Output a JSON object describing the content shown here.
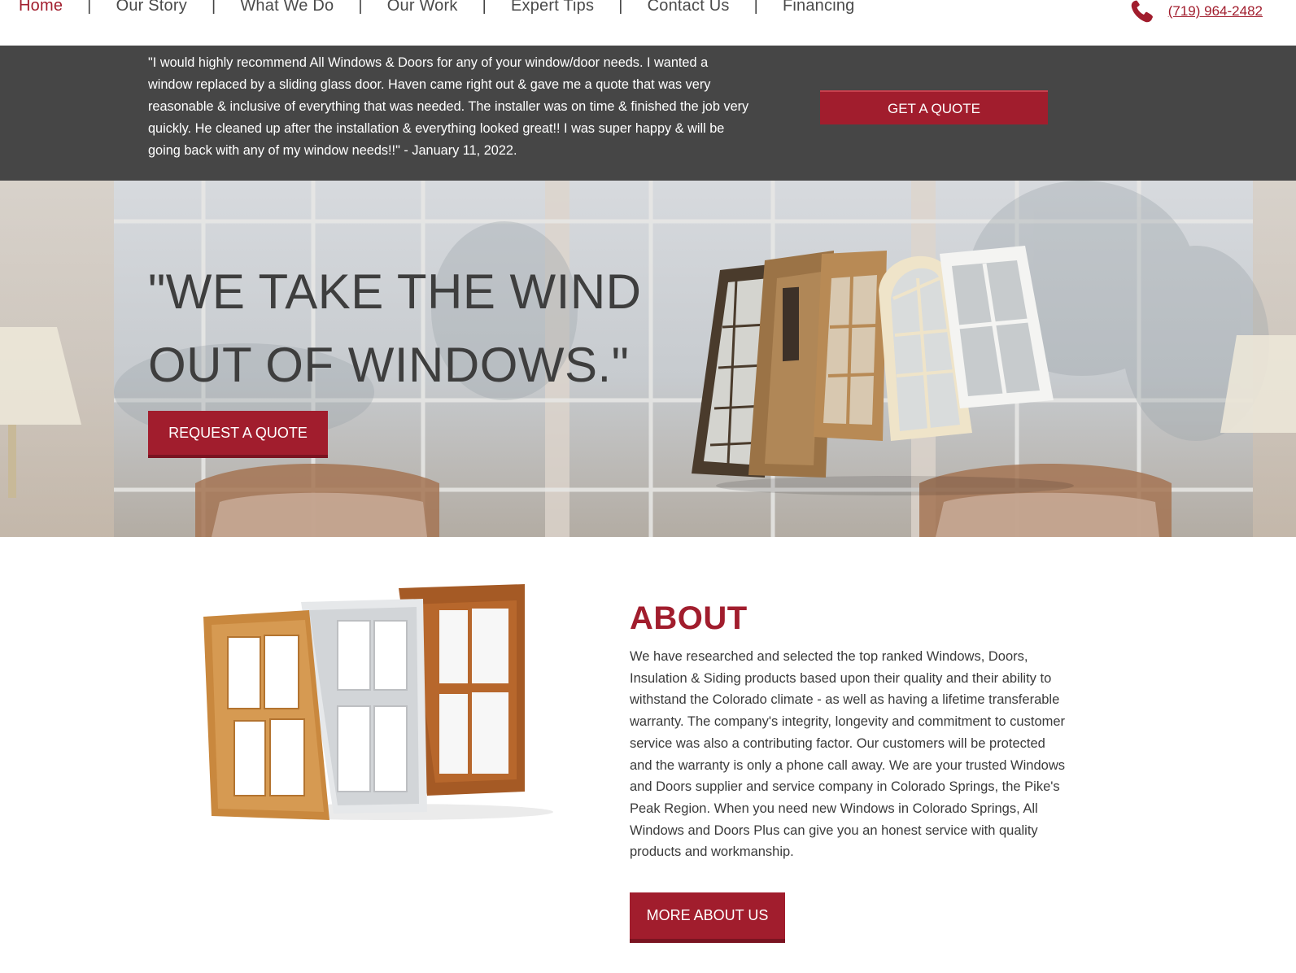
{
  "nav": {
    "items": [
      {
        "label": "Home",
        "active": true
      },
      {
        "label": "Our Story"
      },
      {
        "label": "What We Do"
      },
      {
        "label": "Our Work"
      },
      {
        "label": "Expert Tips"
      },
      {
        "label": "Contact Us"
      },
      {
        "label": "Financing"
      }
    ],
    "separator": "|",
    "phone": "(719) 964-2482",
    "phone_icon": "phone-icon"
  },
  "testimonial": {
    "quote": "\"I would highly recommend All Windows & Doors for any of your window/door needs. I wanted a window replaced by a sliding glass door. Haven came right out & gave me a quote that was very reasonable & inclusive of everything that was needed. The installer was on time & finished the job very quickly. He cleaned up after the installation & everything looked great!! I was super happy & will be going back with any of my window needs!!\" - January 11, 2022.",
    "button": "GET A QUOTE"
  },
  "hero": {
    "title_line1": "\"WE TAKE THE WIND",
    "title_line2": "OUT OF WINDOWS.\"",
    "button": "REQUEST A QUOTE"
  },
  "about": {
    "heading": "ABOUT",
    "text": "We have researched and selected the top ranked Windows, Doors, Insulation & Siding products based upon their quality and their ability to withstand the Colorado climate - as well as having a lifetime transferable warranty. The company's integrity, longevity and commitment to customer service was also a contributing factor. Our customers will be protected and the warranty is only a phone call away. We are your trusted Windows and Doors supplier and service company in Colorado Springs, the Pike's Peak Region. When you need new Windows in Colorado Springs, All Windows and Doors Plus can give you an honest service with quality products and workmanship.",
    "button": "MORE ABOUT US"
  },
  "colors": {
    "brand_red": "#a11d2d",
    "testimonial_bg": "#464646",
    "text_dark": "#3e3e3e"
  }
}
